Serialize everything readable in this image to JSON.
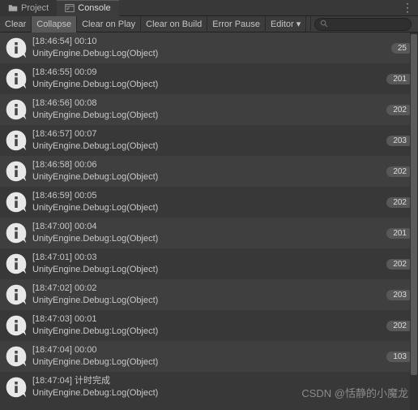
{
  "tabs": {
    "project": "Project",
    "console": "Console"
  },
  "toolbar": {
    "clear": "Clear",
    "collapse": "Collapse",
    "clear_on_play": "Clear on Play",
    "clear_on_build": "Clear on Build",
    "error_pause": "Error Pause",
    "editor": "Editor"
  },
  "logs": [
    {
      "line1": "[18:46:54] 00:10",
      "line2": "UnityEngine.Debug:Log(Object)",
      "count": "25"
    },
    {
      "line1": "[18:46:55] 00:09",
      "line2": "UnityEngine.Debug:Log(Object)",
      "count": "201"
    },
    {
      "line1": "[18:46:56] 00:08",
      "line2": "UnityEngine.Debug:Log(Object)",
      "count": "202"
    },
    {
      "line1": "[18:46:57] 00:07",
      "line2": "UnityEngine.Debug:Log(Object)",
      "count": "203"
    },
    {
      "line1": "[18:46:58] 00:06",
      "line2": "UnityEngine.Debug:Log(Object)",
      "count": "202"
    },
    {
      "line1": "[18:46:59] 00:05",
      "line2": "UnityEngine.Debug:Log(Object)",
      "count": "202"
    },
    {
      "line1": "[18:47:00] 00:04",
      "line2": "UnityEngine.Debug:Log(Object)",
      "count": "201"
    },
    {
      "line1": "[18:47:01] 00:03",
      "line2": "UnityEngine.Debug:Log(Object)",
      "count": "202"
    },
    {
      "line1": "[18:47:02] 00:02",
      "line2": "UnityEngine.Debug:Log(Object)",
      "count": "203"
    },
    {
      "line1": "[18:47:03] 00:01",
      "line2": "UnityEngine.Debug:Log(Object)",
      "count": "202"
    },
    {
      "line1": "[18:47:04] 00:00",
      "line2": "UnityEngine.Debug:Log(Object)",
      "count": "103"
    },
    {
      "line1": "[18:47:04] 计时完成",
      "line2": "UnityEngine.Debug:Log(Object)",
      "count": ""
    }
  ],
  "watermark": "CSDN @恬静的小魔龙"
}
